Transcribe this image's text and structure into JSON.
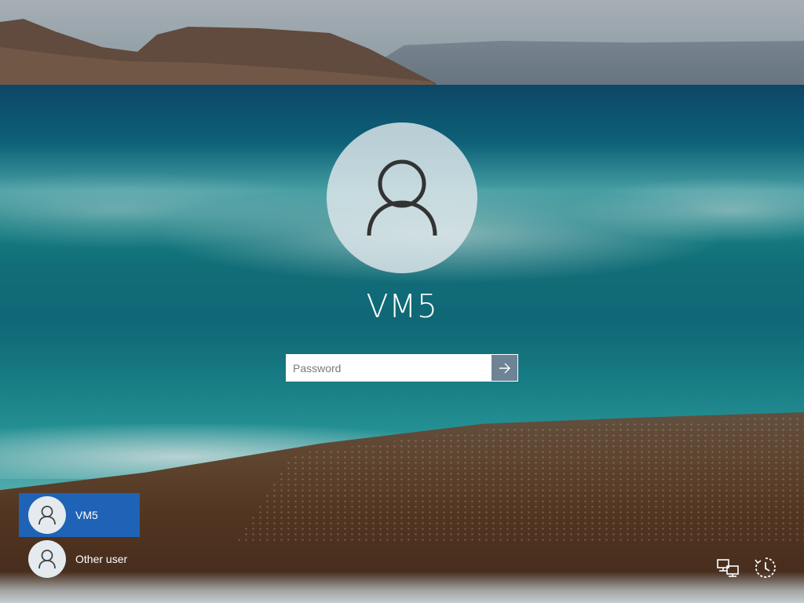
{
  "login": {
    "username": "VM5",
    "password_placeholder": "Password",
    "submit_icon": "arrow-right-icon"
  },
  "user_list": {
    "items": [
      {
        "label": "VM5",
        "selected": true,
        "icon": "user-icon"
      },
      {
        "label": "Other user",
        "selected": false,
        "icon": "user-icon"
      }
    ]
  },
  "system_tray": {
    "network_icon": "network-icon",
    "accessibility_icon": "ease-of-access-icon"
  },
  "colors": {
    "selected_user_bg": "#1e63b5",
    "submit_button_bg": "#6e8394",
    "text": "#ffffff"
  }
}
